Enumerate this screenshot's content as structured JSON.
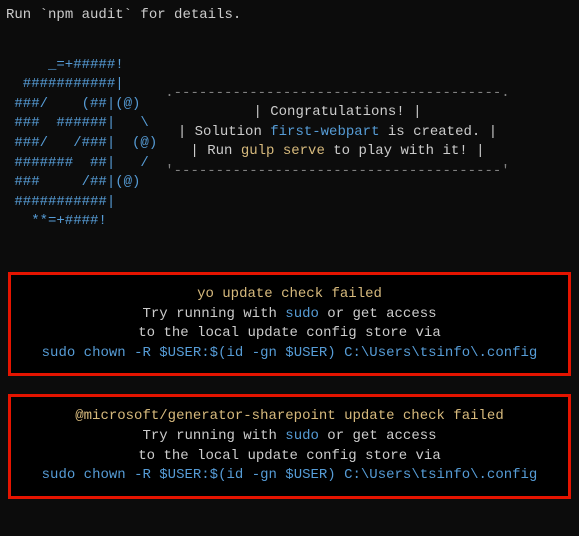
{
  "top": {
    "prefix": "Run ",
    "cmd": "`npm audit`",
    "suffix": " for details."
  },
  "ascii": {
    "art": "     _=+#####!\n  ###########|\n ###/    (##|(@)\n ###  ######|   \\\n ###/   /###|  (@)\n #######  ##|   /\n ###     /##|(@)\n ###########|\n   **=+####!"
  },
  "congrats": {
    "border_top": ".---------------------------------------.",
    "line1": "          Congratulations!             ",
    "line2a": " Solution ",
    "solution": "first-webpart",
    "line2b": " is created.  ",
    "line3a": "   Run ",
    "gulp": "gulp serve",
    "line3b": " to play with it!  ",
    "border_bottom": "'---------------------------------------'",
    "pipe": "|"
  },
  "error1": {
    "title": "yo update check failed",
    "l2a": "Try running with ",
    "sudo": "sudo",
    "l2b": " or get access",
    "l3": "to the local update config store via",
    "cmd": "sudo chown -R $USER:$(id -gn $USER) C:\\Users\\tsinfo\\.config"
  },
  "error2": {
    "title": "@microsoft/generator-sharepoint update check failed",
    "l2a": "Try running with ",
    "sudo": "sudo",
    "l2b": " or get access",
    "l3": "to the local update config store via",
    "cmd": "sudo chown -R $USER:$(id -gn $USER) C:\\Users\\tsinfo\\.config"
  }
}
